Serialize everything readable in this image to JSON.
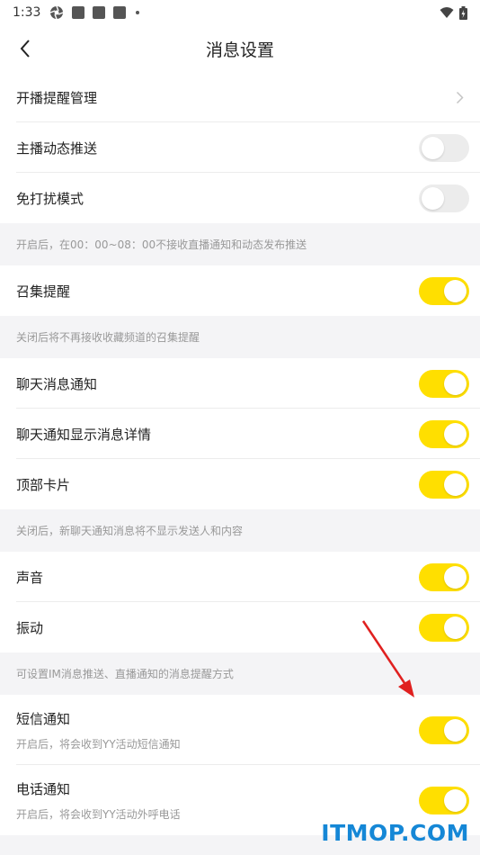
{
  "status_bar": {
    "time": "1:33"
  },
  "header": {
    "title": "消息设置"
  },
  "rows": {
    "live_reminder": {
      "label": "开播提醒管理"
    },
    "anchor_push": {
      "label": "主播动态推送",
      "on": false
    },
    "dnd": {
      "label": "免打扰模式",
      "on": false
    },
    "gather": {
      "label": "召集提醒",
      "on": true
    },
    "chat_notify": {
      "label": "聊天消息通知",
      "on": true
    },
    "chat_detail": {
      "label": "聊天通知显示消息详情",
      "on": true
    },
    "top_card": {
      "label": "顶部卡片",
      "on": true
    },
    "sound": {
      "label": "声音",
      "on": true
    },
    "vibrate": {
      "label": "振动",
      "on": true
    },
    "sms": {
      "label": "短信通知",
      "sub": "开启后，将会收到YY活动短信通知",
      "on": true
    },
    "phone": {
      "label": "电话通知",
      "sub": "开启后，将会收到YY活动外呼电话",
      "on": true
    }
  },
  "notes": {
    "dnd": "开启后，在00：00~08：00不接收直播通知和动态发布推送",
    "gather": "关闭后将不再接收收藏频道的召集提醒",
    "chat": "关闭后，新聊天通知消息将不显示发送人和内容",
    "im": "可设置IM消息推送、直播通知的消息提醒方式"
  },
  "watermark": "ITMOP.COM",
  "colors": {
    "toggle_on": "#ffdf00",
    "toggle_off": "#ececec",
    "arrow": "#e0201f",
    "watermark": "#1587d6"
  },
  "icons": {
    "back": "chevron-left-icon",
    "chevron": "chevron-right-icon",
    "wifi": "wifi-icon",
    "battery": "battery-icon"
  }
}
